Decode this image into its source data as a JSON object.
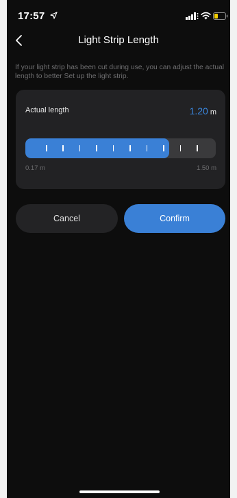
{
  "status_bar": {
    "time": "17:57",
    "icons": [
      "location-icon",
      "signal-icon",
      "wifi-icon",
      "battery-icon"
    ]
  },
  "nav": {
    "title": "Light Strip Length",
    "back_icon": "chevron-left-icon"
  },
  "description": "If your light strip has been cut during use, you can adjust the actual length to better Set up the light strip.",
  "length_card": {
    "label": "Actual length",
    "value": "1.20",
    "unit": "m",
    "slider": {
      "min_label": "0.17 m",
      "max_label": "1.50 m",
      "min": 0.17,
      "max": 1.5,
      "value": 1.2,
      "fill_fraction": 0.755,
      "tick_count": 10
    }
  },
  "buttons": {
    "cancel": "Cancel",
    "confirm": "Confirm"
  },
  "colors": {
    "accent": "#3a80d6",
    "background": "#0d0d0d",
    "card": "#222224",
    "value_text": "#3a87e0",
    "battery_low": "#f5d000"
  }
}
